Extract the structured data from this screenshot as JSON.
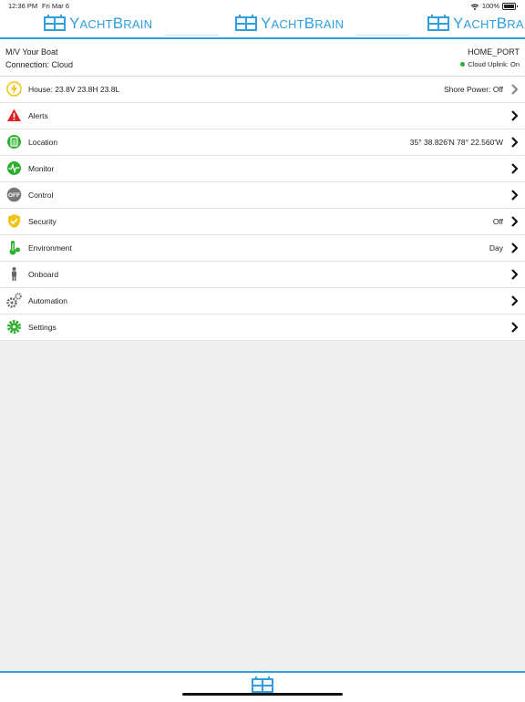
{
  "status_bar": {
    "time": "12:36 PM",
    "date": "Fri Mar 6",
    "battery": "100%",
    "wifi_icon": "wifi-icon",
    "battery_icon": "battery-icon"
  },
  "brand": {
    "first_letter_y": "Y",
    "rest_y": "ACHT",
    "first_letter_b": "B",
    "rest_b": "RAIN",
    "color": "#2f9fe0"
  },
  "vessel": {
    "name": "M/V Your Boat",
    "connection": "Connection: Cloud",
    "port": "HOME_PORT",
    "uplink": "Cloud Uplink: On",
    "uplink_color": "#2db02d"
  },
  "menu": [
    {
      "label": "House: 23.8V 23.8H 23.8L",
      "value": "Shore Power: Off",
      "icon": "lightning-icon",
      "icon_color": "#f2c418",
      "chevron_color": "#888888"
    },
    {
      "label": "Alerts",
      "value": "",
      "icon": "warning-icon",
      "icon_color": "#e02020",
      "chevron_color": "#111111"
    },
    {
      "label": "Location",
      "value": "35° 38.826'N 78° 22.560'W",
      "icon": "gps-icon",
      "icon_color": "#2db02d",
      "chevron_color": "#111111"
    },
    {
      "label": "Monitor",
      "value": "",
      "icon": "pulse-icon",
      "icon_color": "#2db02d",
      "chevron_color": "#111111"
    },
    {
      "label": "Control",
      "value": "",
      "icon": "off-icon",
      "icon_color": "#777777",
      "chevron_color": "#111111"
    },
    {
      "label": "Security",
      "value": "Off",
      "icon": "shield-icon",
      "icon_color": "#f2c418",
      "chevron_color": "#111111"
    },
    {
      "label": "Environment",
      "value": "Day",
      "icon": "thermometer-icon",
      "icon_color": "#2db02d",
      "chevron_color": "#111111"
    },
    {
      "label": "Onboard",
      "value": "",
      "icon": "person-icon",
      "icon_color": "#666666",
      "chevron_color": "#111111"
    },
    {
      "label": "Automation",
      "value": "",
      "icon": "gears-icon",
      "icon_color": "#666666",
      "chevron_color": "#111111"
    },
    {
      "label": "Settings",
      "value": "",
      "icon": "gear-icon",
      "icon_color": "#2db02d",
      "chevron_color": "#111111"
    }
  ]
}
